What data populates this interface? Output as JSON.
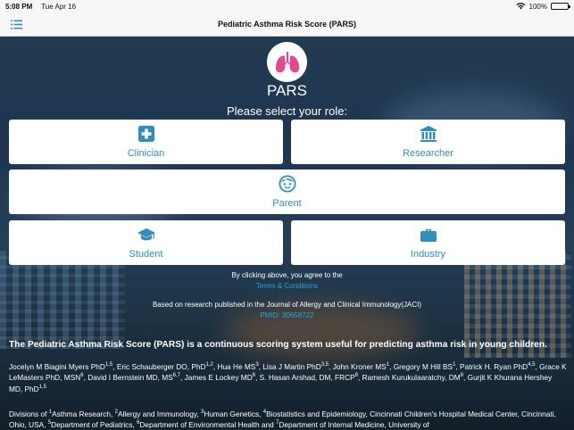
{
  "status_bar": {
    "time": "5:08 PM",
    "date": "Tue Apr 16",
    "battery": "100%"
  },
  "navbar": {
    "title": "Pediatric Asthma Risk Score (PARS)"
  },
  "app": {
    "name": "PARS",
    "prompt": "Please select your role:"
  },
  "roles": [
    {
      "label": "Clinician",
      "icon": "medical-cross-icon"
    },
    {
      "label": "Researcher",
      "icon": "institution-icon"
    },
    {
      "label": "Parent",
      "icon": "child-face-icon"
    },
    {
      "label": "Student",
      "icon": "graduation-cap-icon"
    },
    {
      "label": "Industry",
      "icon": "briefcase-icon"
    }
  ],
  "footer": {
    "agree_text": "By clicking above, you agree to the",
    "terms_link": "Terms & Conditions",
    "based_text": "Based on research published in the Journal of Allergy and Clinical Immunology(JACI)",
    "pmid_link": "PMID: 30658722",
    "headline": "The Pediatric Asthma Risk Score (PARS) is a continuous scoring system useful for predicting asthma risk in young children.",
    "authors": [
      {
        "name": "Jocelyn M Biagini Myers PhD",
        "sup": "1,5"
      },
      {
        "name": "Eric Schauberger DO, PhD",
        "sup": "1,2"
      },
      {
        "name": "Hua He MS",
        "sup": "3"
      },
      {
        "name": "Lisa J Martin PhD",
        "sup": "3,5"
      },
      {
        "name": "John Kroner MS",
        "sup": "1"
      },
      {
        "name": "Gregory M Hill BS",
        "sup": "1"
      },
      {
        "name": "Patrick H. Ryan PhD",
        "sup": "4,5"
      },
      {
        "name": "Grace K LeMasters PhD, MSN",
        "sup": "6"
      },
      {
        "name": "David I Bernstein MD, MS",
        "sup": "6,7"
      },
      {
        "name": "James E Lockey MD",
        "sup": "6"
      },
      {
        "name": "S. Hasan Arshad, DM, FRCP",
        "sup": "8"
      },
      {
        "name": "Ramesh Kurukulaaratchy, DM",
        "sup": "8"
      },
      {
        "name": "Gurjit K Khurana Hershey MD, PhD",
        "sup": "1,5"
      }
    ],
    "affiliations": [
      {
        "prefix": "Divisions of ",
        "sup": "1",
        "text": "Asthma Research, "
      },
      {
        "prefix": "",
        "sup": "2",
        "text": "Allergy and Immunology, "
      },
      {
        "prefix": "",
        "sup": "3",
        "text": "Human Genetics, "
      },
      {
        "prefix": "",
        "sup": "4",
        "text": "Biostatistics and Epidemiology, Cincinnati Children's Hospital Medical Center, Cincinnati, Ohio, USA, "
      },
      {
        "prefix": "",
        "sup": "5",
        "text": "Department of Pediatrics, "
      },
      {
        "prefix": "",
        "sup": "6",
        "text": "Department of Environmental Health and "
      },
      {
        "prefix": "",
        "sup": "7",
        "text": "Department of Internal Medicine, University of"
      }
    ]
  },
  "colors": {
    "accent": "#2e8fbf",
    "link": "#2aa3d8",
    "logo_lungs": "#e8478c"
  }
}
